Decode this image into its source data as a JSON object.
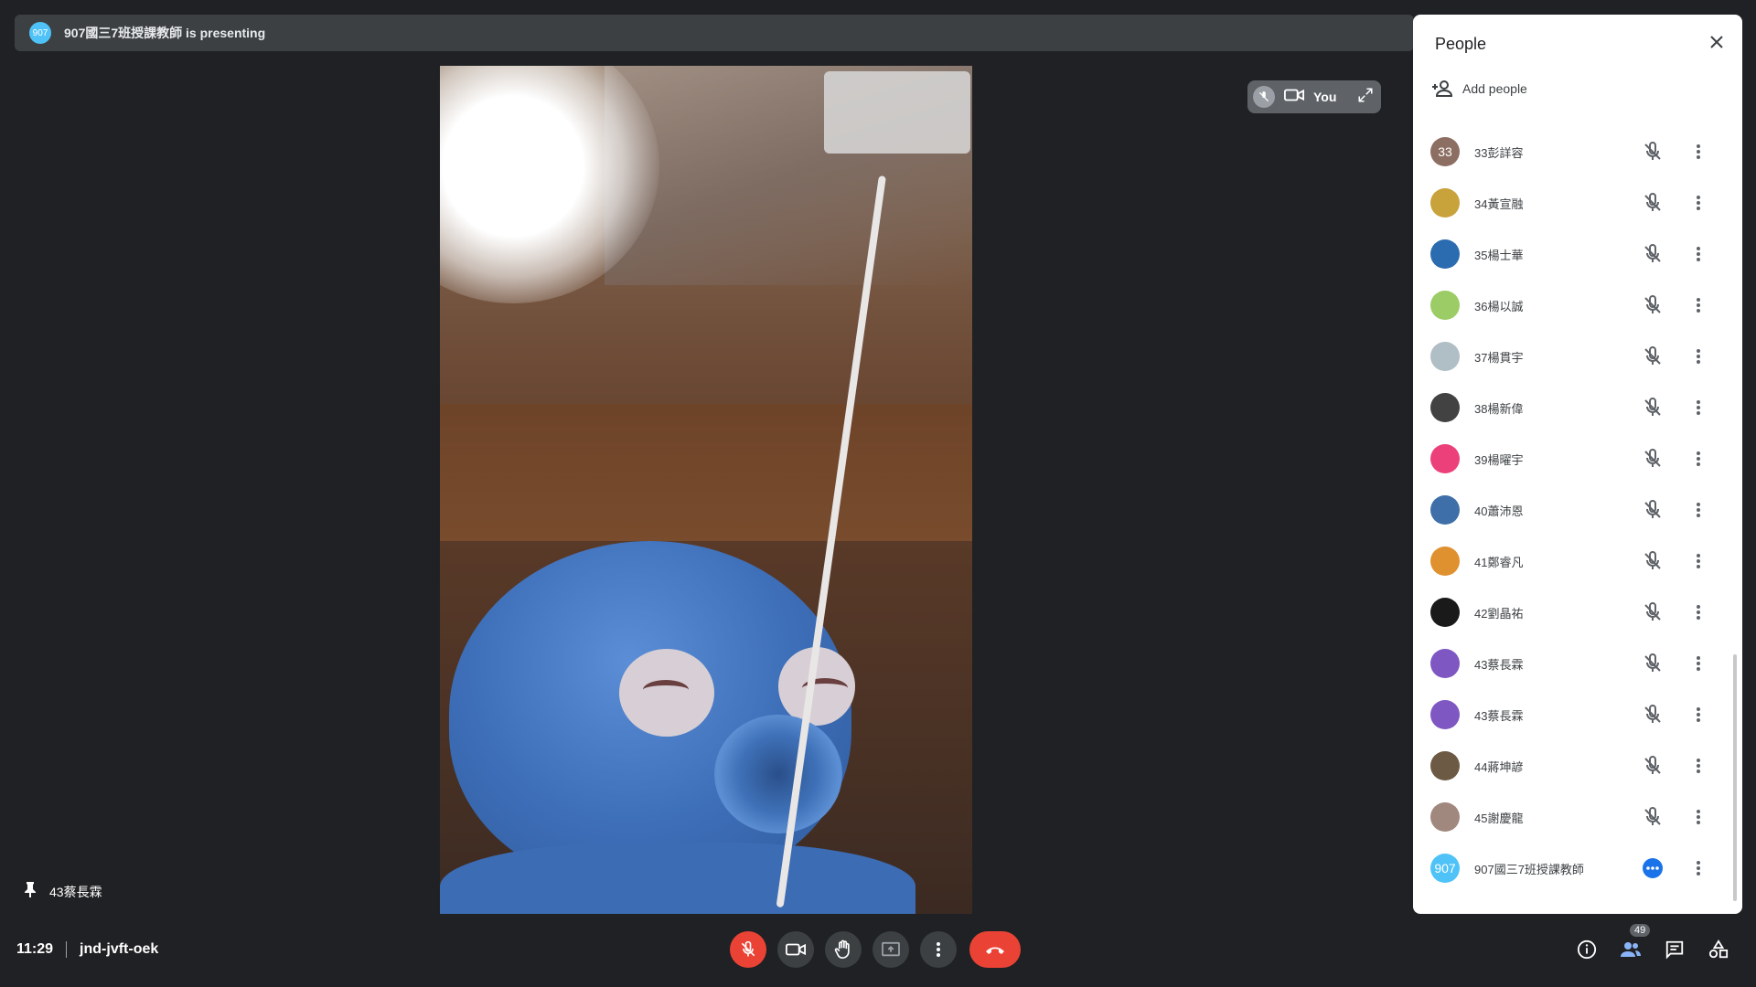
{
  "presenting_banner": {
    "avatar_text": "907",
    "text": "907國三7班授課教師 is presenting"
  },
  "self_tile": {
    "label": "You"
  },
  "pinned": {
    "label": "43蔡長霖"
  },
  "meeting": {
    "time": "11:29",
    "code": "jnd-jvft-oek"
  },
  "controls": {
    "mic": "mic-off-icon",
    "camera": "video-camera-icon",
    "raise_hand": "hand-icon",
    "present": "present-screen-icon",
    "more": "more-vert-icon",
    "leave": "end-call-icon"
  },
  "right_controls": {
    "people_count": "49"
  },
  "people_panel": {
    "title": "People",
    "add_people": "Add people",
    "participants": [
      {
        "avatar": "33",
        "name": "33彭詳容",
        "color": "#8d6e63"
      },
      {
        "avatar": "",
        "name": "34黃宣融",
        "color": "#c8a23a"
      },
      {
        "avatar": "",
        "name": "35楊士華",
        "color": "#2b6cb0"
      },
      {
        "avatar": "",
        "name": "36楊以誠",
        "color": "#9ccc65"
      },
      {
        "avatar": "",
        "name": "37楊貫宇",
        "color": "#b0bec5"
      },
      {
        "avatar": "",
        "name": "38楊新偉",
        "color": "#424242"
      },
      {
        "avatar": "",
        "name": "39楊曜宇",
        "color": "#ec407a"
      },
      {
        "avatar": "",
        "name": "40蕭沛恩",
        "color": "#3f6fa8"
      },
      {
        "avatar": "",
        "name": "41鄭睿凡",
        "color": "#e0912f"
      },
      {
        "avatar": "",
        "name": "42劉晶祐",
        "color": "#1a1a1a"
      },
      {
        "avatar": "",
        "name": "43蔡長霖",
        "color": "#7e57c2"
      },
      {
        "avatar": "",
        "name": "43蔡長霖",
        "color": "#7e57c2"
      },
      {
        "avatar": "",
        "name": "44蔣坤諺",
        "color": "#6d5a44"
      },
      {
        "avatar": "",
        "name": "45謝慶龍",
        "color": "#a1887f"
      },
      {
        "avatar": "907",
        "name": "907國三7班授課教師",
        "color": "#4fc3f7",
        "speaking": true
      }
    ]
  }
}
